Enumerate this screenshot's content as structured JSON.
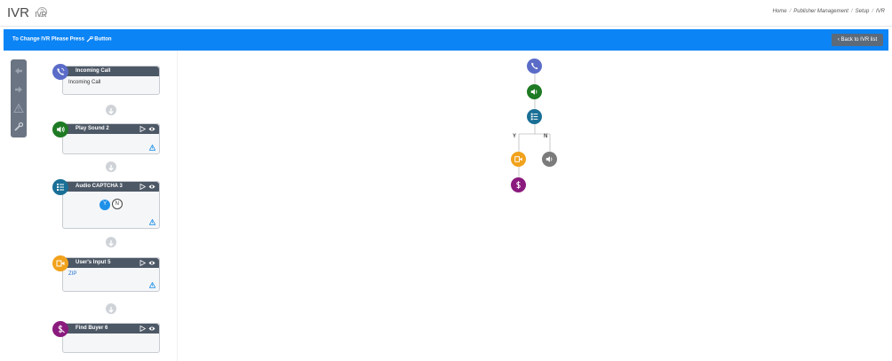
{
  "header": {
    "title": "IVR",
    "subtitle": "IVR",
    "breadcrumb": [
      "Home",
      "Publisher Management",
      "Setup",
      "IVR"
    ]
  },
  "banner": {
    "text_before": "To Change IVR Please Press",
    "text_after": "Button",
    "back_label": "Back to IVR list"
  },
  "colors": {
    "accent": "#0b84f5",
    "call": "#5b6cc8",
    "sound": "#1e7a24",
    "captcha": "#1a6f96",
    "input": "#f1a21c",
    "buyer": "#8a1a7e",
    "sound_grey": "#7b7b7b"
  },
  "nodes": [
    {
      "title": "Incoming Call",
      "body": "Incoming Call",
      "icon": "phone-icon"
    },
    {
      "title": "Play Sound 2",
      "body": "",
      "icon": "speaker-icon"
    },
    {
      "title": "Audio CAPTCHA 3",
      "body": "",
      "icon": "list-icon",
      "options": [
        "Y",
        "N"
      ]
    },
    {
      "title": "User's Input 5",
      "body": "ZIP",
      "icon": "input-icon"
    },
    {
      "title": "Find Buyer 6",
      "body": "",
      "icon": "buyer-icon"
    }
  ],
  "flow": {
    "yes_label": "Y",
    "no_label": "N"
  }
}
